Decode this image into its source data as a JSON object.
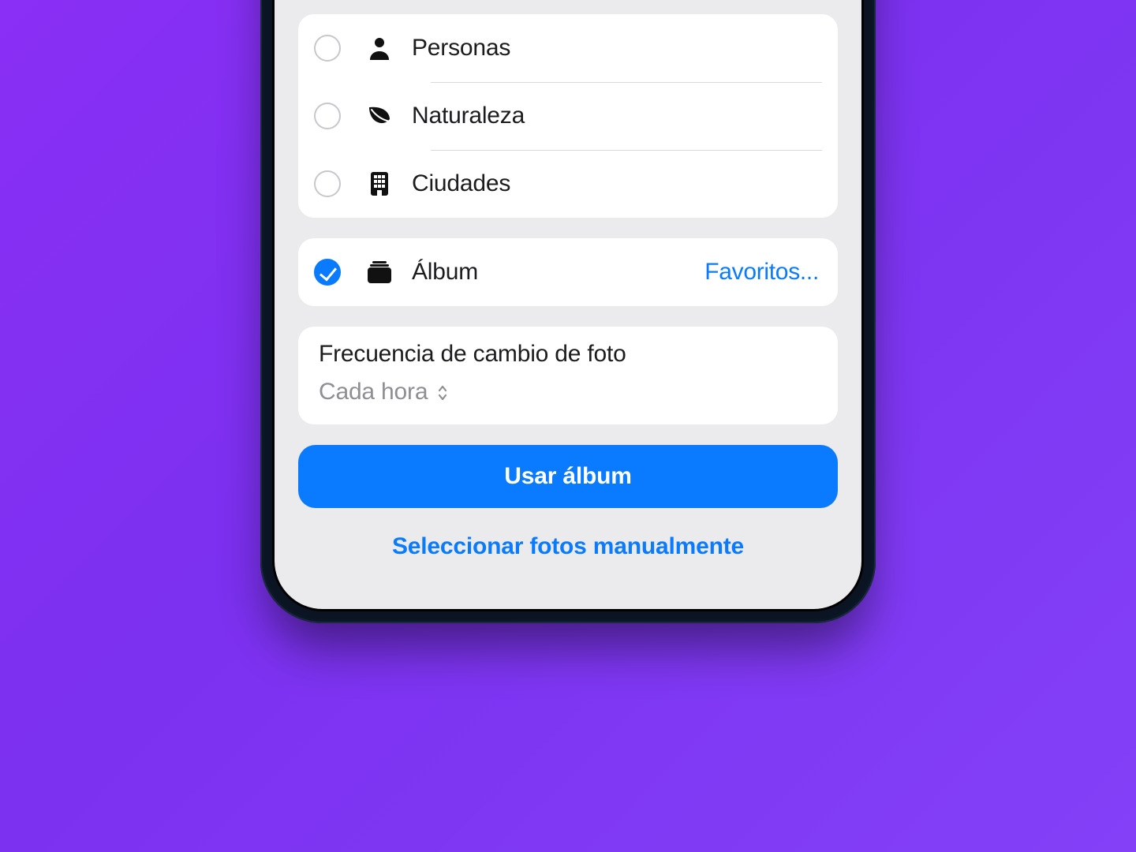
{
  "categories": [
    {
      "label": "Personas",
      "icon": "person",
      "selected": false
    },
    {
      "label": "Naturaleza",
      "icon": "leaf",
      "selected": false
    },
    {
      "label": "Ciudades",
      "icon": "building",
      "selected": false
    }
  ],
  "album": {
    "label": "Álbum",
    "selected": true,
    "value": "Favoritos...",
    "icon": "album"
  },
  "frequency": {
    "title": "Frecuencia de cambio de foto",
    "value": "Cada hora"
  },
  "primary_button": "Usar álbum",
  "secondary_link": "Seleccionar fotos manualmente",
  "colors": {
    "accent": "#0a7bff"
  }
}
